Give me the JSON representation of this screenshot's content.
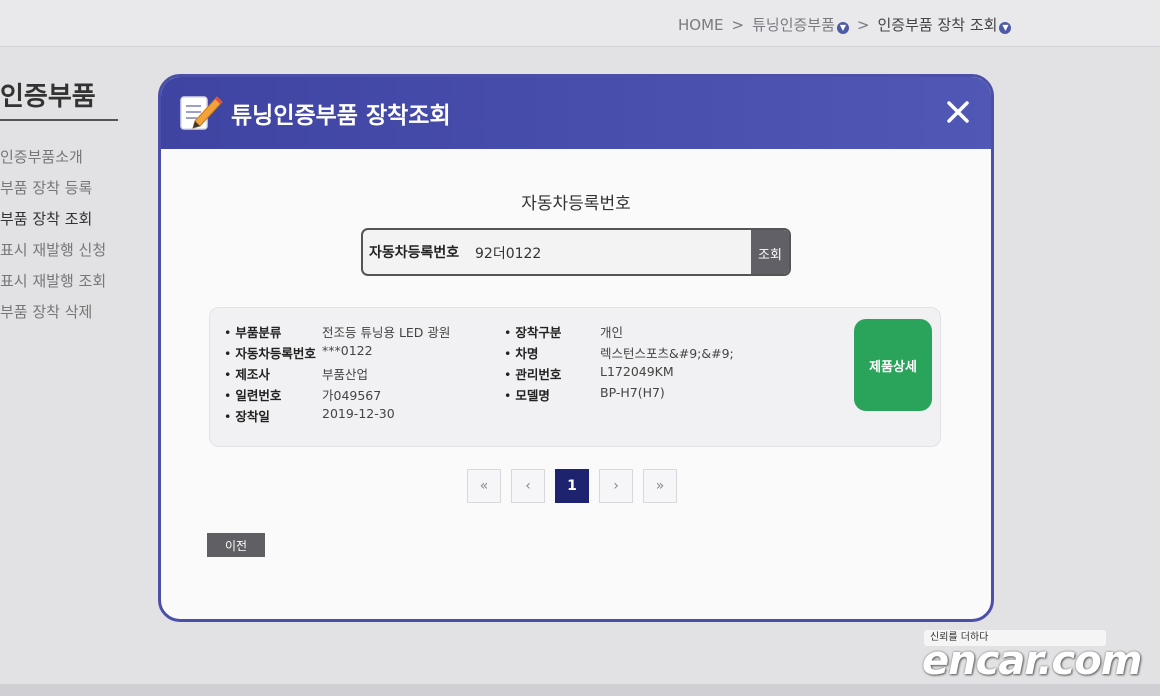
{
  "breadcrumb": {
    "home": "HOME",
    "sep": ">",
    "level1": "튜닝인증부품",
    "level2": "인증부품 장착 조회"
  },
  "sidebar": {
    "title": "인증부품",
    "items": [
      {
        "label": "인증부품소개"
      },
      {
        "label": "부품 장착 등록"
      },
      {
        "label": "부품 장착 조회"
      },
      {
        "label": "표시 재발행 신청"
      },
      {
        "label": "표시 재발행 조회"
      },
      {
        "label": "부품 장착 삭제"
      }
    ]
  },
  "modal": {
    "title": "튜닝인증부품 장착조회",
    "section_title": "자동차등록번호",
    "search": {
      "label": "자동차등록번호",
      "value": "92더0122",
      "button": "조회"
    },
    "result": {
      "left": [
        {
          "key": "부품분류",
          "value": "전조등 튜닝용 LED 광원"
        },
        {
          "key": "자동차등록번호",
          "value": "***0122"
        },
        {
          "key": "제조사",
          "value": "부품산업"
        },
        {
          "key": "일련번호",
          "value": "가049567"
        },
        {
          "key": "장착일",
          "value": "2019-12-30"
        }
      ],
      "right": [
        {
          "key": "장착구분",
          "value": "개인"
        },
        {
          "key": "차명",
          "value": "렉스턴스포츠&#9;&#9;"
        },
        {
          "key": "관리번호",
          "value": "L172049KM"
        },
        {
          "key": "모델명",
          "value": "BP-H7(H7)"
        }
      ],
      "detail_button": "제품상세"
    },
    "pagination": {
      "first": "«",
      "prev": "‹",
      "current": "1",
      "next": "›",
      "last": "»"
    },
    "prev_button": "이전"
  },
  "watermark": {
    "tagline": "신뢰를 더하다",
    "logo": "encar.com"
  }
}
